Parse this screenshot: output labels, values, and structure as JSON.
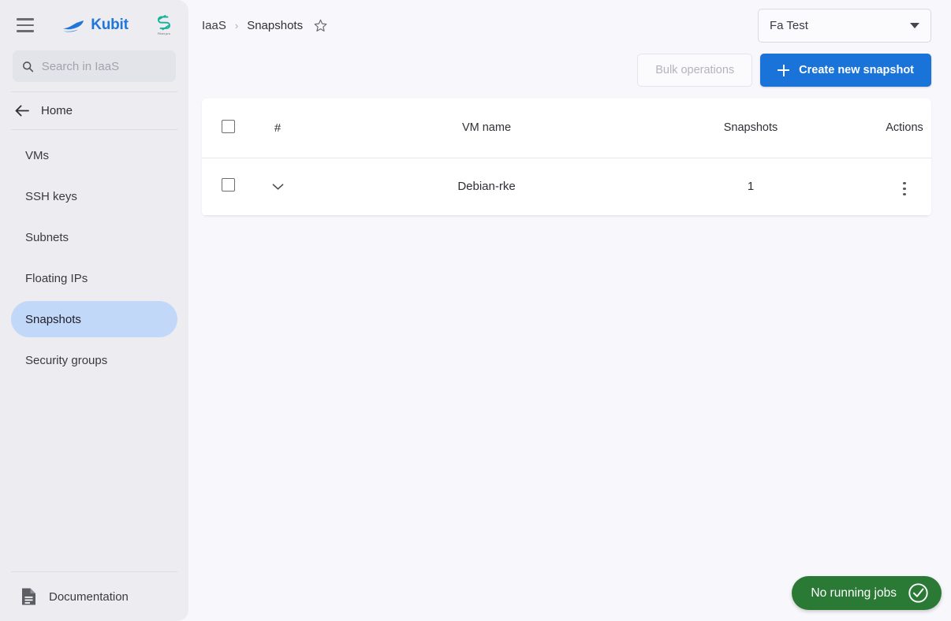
{
  "sidebar": {
    "brand": {
      "name": "Kubit",
      "logo_icon": "boat-logo-icon"
    },
    "corp_logo": {
      "icon": "s-mark-icon",
      "subtitle": "Fiber.pro"
    },
    "menu_icon": "hamburger-menu-icon",
    "search": {
      "placeholder": "Search in IaaS",
      "value": "",
      "icon": "search-icon"
    },
    "home": {
      "label": "Home",
      "icon": "arrow-left-icon"
    },
    "items": [
      {
        "label": "VMs",
        "active": false
      },
      {
        "label": "SSH keys",
        "active": false
      },
      {
        "label": "Subnets",
        "active": false
      },
      {
        "label": "Floating IPs",
        "active": false
      },
      {
        "label": "Snapshots",
        "active": true
      },
      {
        "label": "Security groups",
        "active": false
      }
    ],
    "documentation": {
      "label": "Documentation",
      "icon": "document-icon"
    }
  },
  "header": {
    "breadcrumb": [
      "IaaS",
      "Snapshots"
    ],
    "breadcrumb_separator": "›",
    "favorite_icon": "star-outline-icon",
    "project_select": {
      "value": "Fa Test",
      "icon": "chevron-down-icon"
    }
  },
  "toolbar": {
    "bulk_operations_label": "Bulk operations",
    "create_label": "Create new snapshot",
    "create_icon": "plus-icon"
  },
  "table": {
    "columns": [
      "",
      "#",
      "VM name",
      "Snapshots",
      "Actions"
    ],
    "select_all_icon": "checkbox-unchecked-icon",
    "rows": [
      {
        "checkbox_icon": "checkbox-unchecked-icon",
        "expand_icon": "chevron-down-icon",
        "vm_name": "Debian-rke",
        "snapshots": "1",
        "actions_icon": "kebab-menu-icon"
      }
    ]
  },
  "status": {
    "jobs_label": "No running jobs",
    "jobs_icon": "check-circle-icon"
  },
  "colors": {
    "brand_blue": "#2176d9",
    "primary_button": "#1a73d9",
    "active_nav": "#c2d8f9",
    "status_green": "#2a7a35",
    "sidebar_bg": "#ececf1",
    "main_bg": "#f7f7fc",
    "corp_teal": "#1aab96"
  }
}
